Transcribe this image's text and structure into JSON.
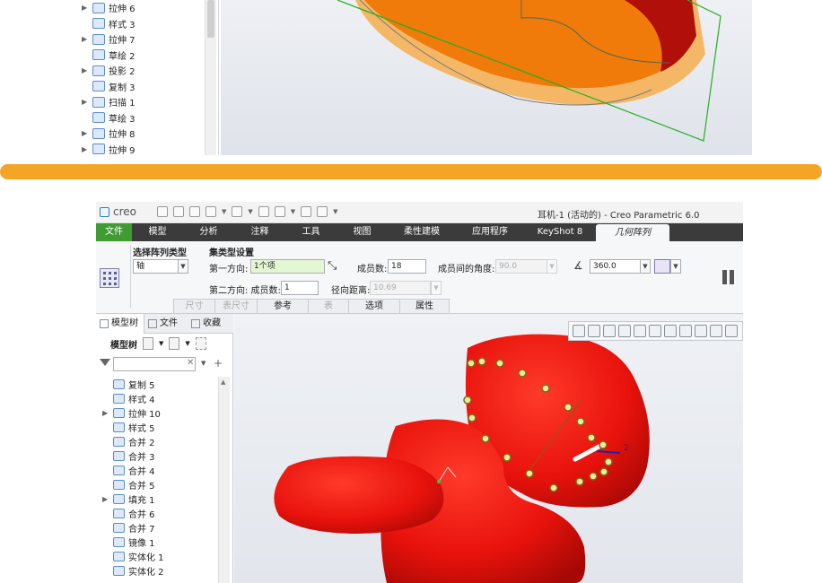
{
  "top_tree": {
    "items": [
      {
        "label": "拉伸 6",
        "expandable": true,
        "icon": "extrude-icon"
      },
      {
        "label": "样式 3",
        "expandable": false,
        "icon": "style-icon"
      },
      {
        "label": "拉伸 7",
        "expandable": true,
        "icon": "extrude-icon"
      },
      {
        "label": "草绘 2",
        "expandable": false,
        "icon": "sketch-icon"
      },
      {
        "label": "投影 2",
        "expandable": true,
        "icon": "projection-icon"
      },
      {
        "label": "复制 3",
        "expandable": false,
        "icon": "copy-icon"
      },
      {
        "label": "扫描 1",
        "expandable": true,
        "icon": "sweep-icon"
      },
      {
        "label": "草绘 3",
        "expandable": false,
        "icon": "sketch-icon"
      },
      {
        "label": "拉伸 8",
        "expandable": true,
        "icon": "extrude-icon"
      },
      {
        "label": "拉伸 9",
        "expandable": true,
        "icon": "extrude-icon"
      }
    ]
  },
  "colors": {
    "divider": "#f5a526",
    "menubar": "#3b3b3b",
    "file_tab": "#3f9b32",
    "model_red": "#e8120c",
    "model_orange": "#f07a0a"
  },
  "app": {
    "logo": "creo",
    "title": "耳机-1 (活动的) - Creo Parametric 6.0"
  },
  "menu": {
    "tabs": [
      "文件",
      "模型",
      "分析",
      "注释",
      "工具",
      "视图",
      "柔性建模",
      "应用程序",
      "KeyShot 8",
      "几何阵列"
    ],
    "active": "几何阵列"
  },
  "ribbon": {
    "pattern_type_label": "选择阵列类型",
    "pattern_type_value": "轴",
    "set_label": "集类型设置",
    "dir1_label": "第一方向:",
    "dir1_value": "1个项",
    "members_label": "成员数:",
    "members_value": "18",
    "angle_between_label": "成员间的角度:",
    "angle_between_value": "90.0",
    "total_angle_value": "360.0",
    "dir2_label": "第二方向: 成员数:",
    "dir2_value": "1",
    "radial_label": "径向距离:",
    "radial_value": "10.69",
    "subtabs": [
      {
        "label": "尺寸",
        "enabled": false
      },
      {
        "label": "表尺寸",
        "enabled": false
      },
      {
        "label": "参考",
        "enabled": true
      },
      {
        "label": "表",
        "enabled": false
      },
      {
        "label": "选项",
        "enabled": true
      },
      {
        "label": "属性",
        "enabled": true
      }
    ]
  },
  "panel": {
    "tabs": [
      "模型树",
      "文件",
      "收藏"
    ],
    "tree_title": "模型树",
    "filter_placeholder": ""
  },
  "tree": {
    "items": [
      {
        "label": "复制 5",
        "expandable": false,
        "icon": "copy-icon"
      },
      {
        "label": "样式 4",
        "expandable": false,
        "icon": "style-icon"
      },
      {
        "label": "拉伸 10",
        "expandable": true,
        "icon": "extrude-icon"
      },
      {
        "label": "样式 5",
        "expandable": false,
        "icon": "style-icon"
      },
      {
        "label": "合并 2",
        "expandable": false,
        "icon": "merge-icon"
      },
      {
        "label": "合并 3",
        "expandable": false,
        "icon": "merge-icon"
      },
      {
        "label": "合并 4",
        "expandable": false,
        "icon": "merge-icon"
      },
      {
        "label": "合并 5",
        "expandable": false,
        "icon": "merge-icon"
      },
      {
        "label": "填充 1",
        "expandable": true,
        "icon": "fill-icon"
      },
      {
        "label": "合并 6",
        "expandable": false,
        "icon": "merge-icon"
      },
      {
        "label": "合并 7",
        "expandable": false,
        "icon": "merge-icon"
      },
      {
        "label": "镜像 1",
        "expandable": false,
        "icon": "mirror-icon"
      },
      {
        "label": "实体化 1",
        "expandable": false,
        "icon": "solidify-icon"
      },
      {
        "label": "实体化 2",
        "expandable": false,
        "icon": "solidify-icon"
      }
    ]
  },
  "viewport": {
    "axis_label": "2",
    "toolbar_icons": [
      "refit-icon",
      "zoom-in-icon",
      "zoom-out-icon",
      "repaint-icon",
      "display-style-icon",
      "saved-views-icon",
      "view-manager-icon",
      "perspective-icon",
      "datum-display-icon",
      "spin-center-icon",
      "annotation-display-icon"
    ]
  }
}
